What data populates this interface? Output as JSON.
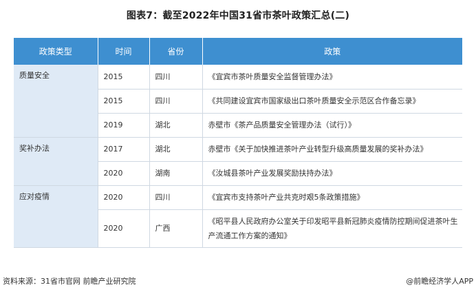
{
  "title": "图表7：截至2022年中国31省市茶叶政策汇总(二)",
  "table": {
    "headers": [
      "政策类型",
      "时间",
      "省份",
      "政策"
    ],
    "groups": [
      {
        "type": "质量安全",
        "rows": [
          {
            "year": "2015",
            "province": "四川",
            "policy": "《宜宾市茶叶质量安全监督管理办法》"
          },
          {
            "year": "2015",
            "province": "四川",
            "policy": "《共同建设宜宾市国家级出口茶叶质量安全示范区合作备忘录》"
          },
          {
            "year": "2019",
            "province": "湖北",
            "policy": "赤壁市《茶产品质量安全管理办法（试行）》"
          }
        ]
      },
      {
        "type": "奖补办法",
        "rows": [
          {
            "year": "2017",
            "province": "湖北",
            "policy": "赤壁市《关于加快推进茶叶产业转型升级高质量发展的奖补办法》"
          },
          {
            "year": "2020",
            "province": "湖南",
            "policy": "《汝城县茶叶产业发展奖励扶持办法》"
          }
        ]
      },
      {
        "type": "应对疫情",
        "rows": [
          {
            "year": "2020",
            "province": "四川",
            "policy": "《宜宾市支持茶叶产业共克时艰5条政策措施》"
          },
          {
            "year": "2020",
            "province": "广西",
            "policy": "《昭平县人民政府办公室关于印发昭平县新冠肺炎疫情防控期间促进茶叶生产流通工作方案的通知》"
          }
        ]
      }
    ]
  },
  "footer": {
    "source": "资料来源：31省市官网 前瞻产业研究院",
    "brand": "@前瞻经济学人APP"
  }
}
